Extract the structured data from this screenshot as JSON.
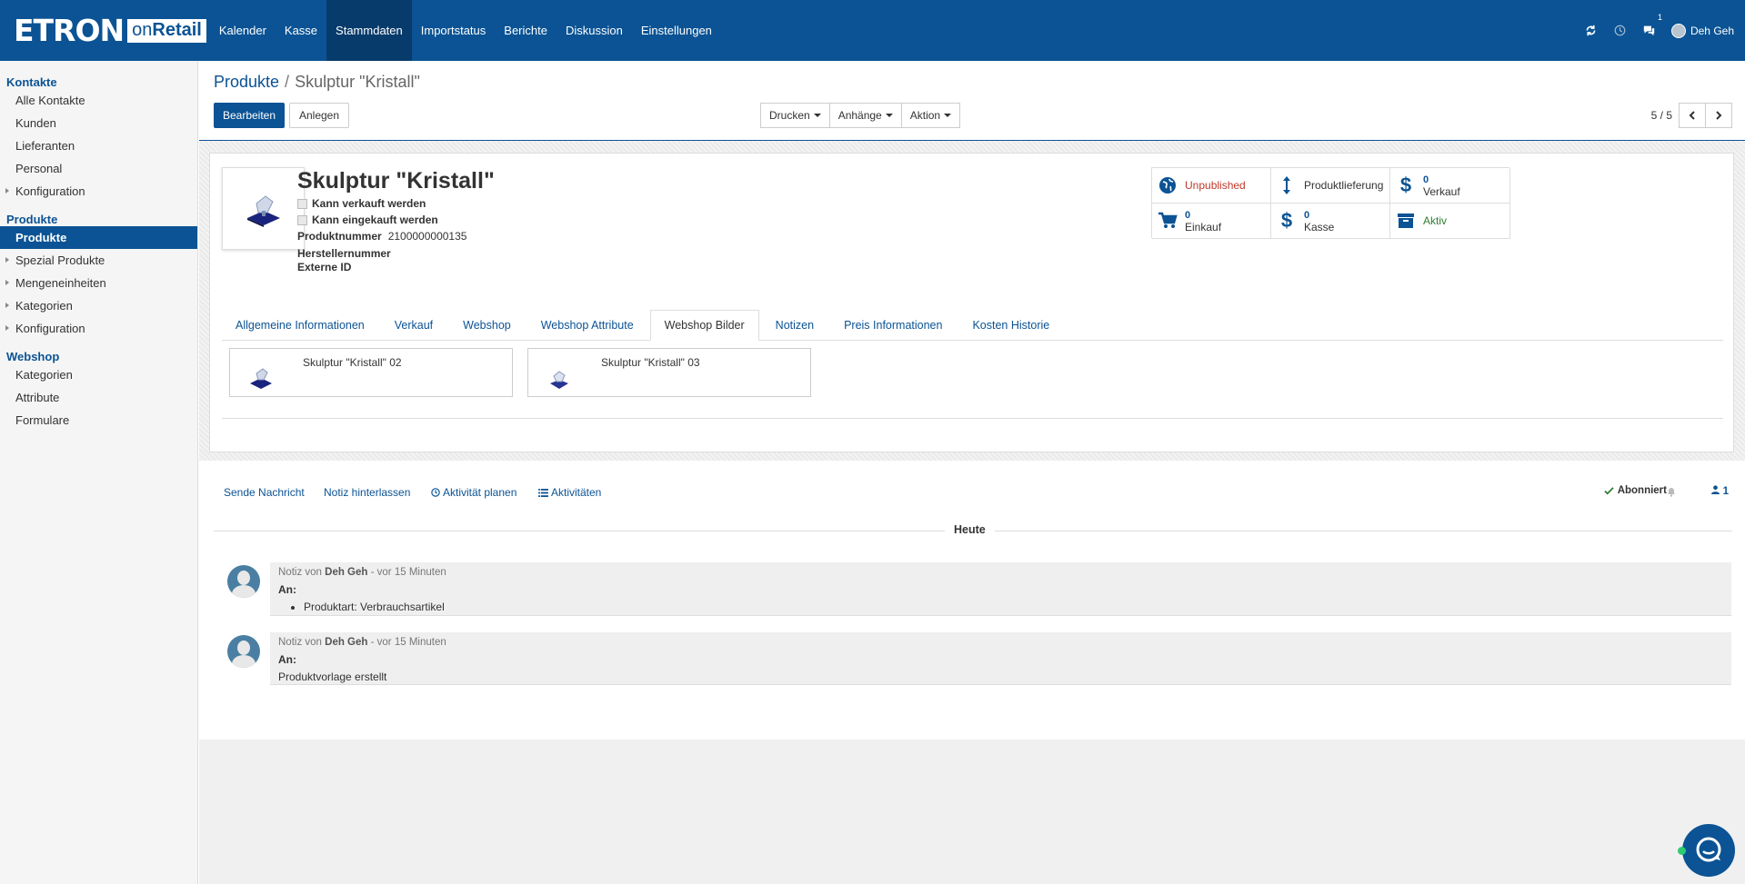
{
  "brand": {
    "name": "ETRON",
    "sub_on": "on",
    "sub_retail": "Retail"
  },
  "nav": [
    "Kalender",
    "Kasse",
    "Stammdaten",
    "Importstatus",
    "Berichte",
    "Diskussion",
    "Einstellungen"
  ],
  "topbar": {
    "notification_count": "1",
    "user": "Deh Geh"
  },
  "sidebar": {
    "kontakte": {
      "title": "Kontakte",
      "items": [
        "Alle Kontakte",
        "Kunden",
        "Lieferanten",
        "Personal",
        "Konfiguration"
      ]
    },
    "produkte": {
      "title": "Produkte",
      "items": [
        "Produkte",
        "Spezial Produkte",
        "Mengeneinheiten",
        "Kategorien",
        "Konfiguration"
      ]
    },
    "webshop": {
      "title": "Webshop",
      "items": [
        "Kategorien",
        "Attribute",
        "Formulare"
      ]
    }
  },
  "breadcrumb": {
    "parent": "Produkte",
    "separator": "/",
    "current": "Skulptur \"Kristall\""
  },
  "buttons": {
    "edit": "Bearbeiten",
    "create": "Anlegen",
    "print": "Drucken",
    "attachments": "Anhänge",
    "action": "Aktion"
  },
  "pager": {
    "text": "5 / 5"
  },
  "product": {
    "title": "Skulptur \"Kristall\"",
    "can_sell": "Kann verkauft werden",
    "can_buy": "Kann eingekauft werden",
    "number_label": "Produktnummer",
    "number": "2100000000135",
    "manufacturer_label": "Herstellernummer",
    "external_label": "Externe ID"
  },
  "smart_buttons": {
    "published": "Unpublished",
    "delivery": "Produktlieferung",
    "sale_count": "0",
    "sale_label": "Verkauf",
    "purchase_count": "0",
    "purchase_label": "Einkauf",
    "pos_count": "0",
    "pos_label": "Kasse",
    "active": "Aktiv"
  },
  "tabs": [
    "Allgemeine Informationen",
    "Verkauf",
    "Webshop",
    "Webshop Attribute",
    "Webshop Bilder",
    "Notizen",
    "Preis Informationen",
    "Kosten Historie"
  ],
  "images": [
    "Skulptur \"Kristall\" 02",
    "Skulptur \"Kristall\" 03"
  ],
  "chatter": {
    "send_message": "Sende Nachricht",
    "log_note": "Notiz hinterlassen",
    "schedule": "Aktivität planen",
    "activities": "Aktivitäten",
    "following": "Abonniert",
    "followers": "1",
    "today": "Heute",
    "messages": [
      {
        "prefix": "Notiz von",
        "author": "Deh Geh",
        "time": "- vor 15 Minuten",
        "to": "An:",
        "body": "Produktart: Verbrauchsartikel"
      },
      {
        "prefix": "Notiz von",
        "author": "Deh Geh",
        "time": "- vor 15 Minuten",
        "to": "An:",
        "body": "Produktvorlage erstellt"
      }
    ]
  },
  "colors": {
    "primary": "#0b5394",
    "unpublished": "#c0392b",
    "active": "#2e7d32"
  }
}
